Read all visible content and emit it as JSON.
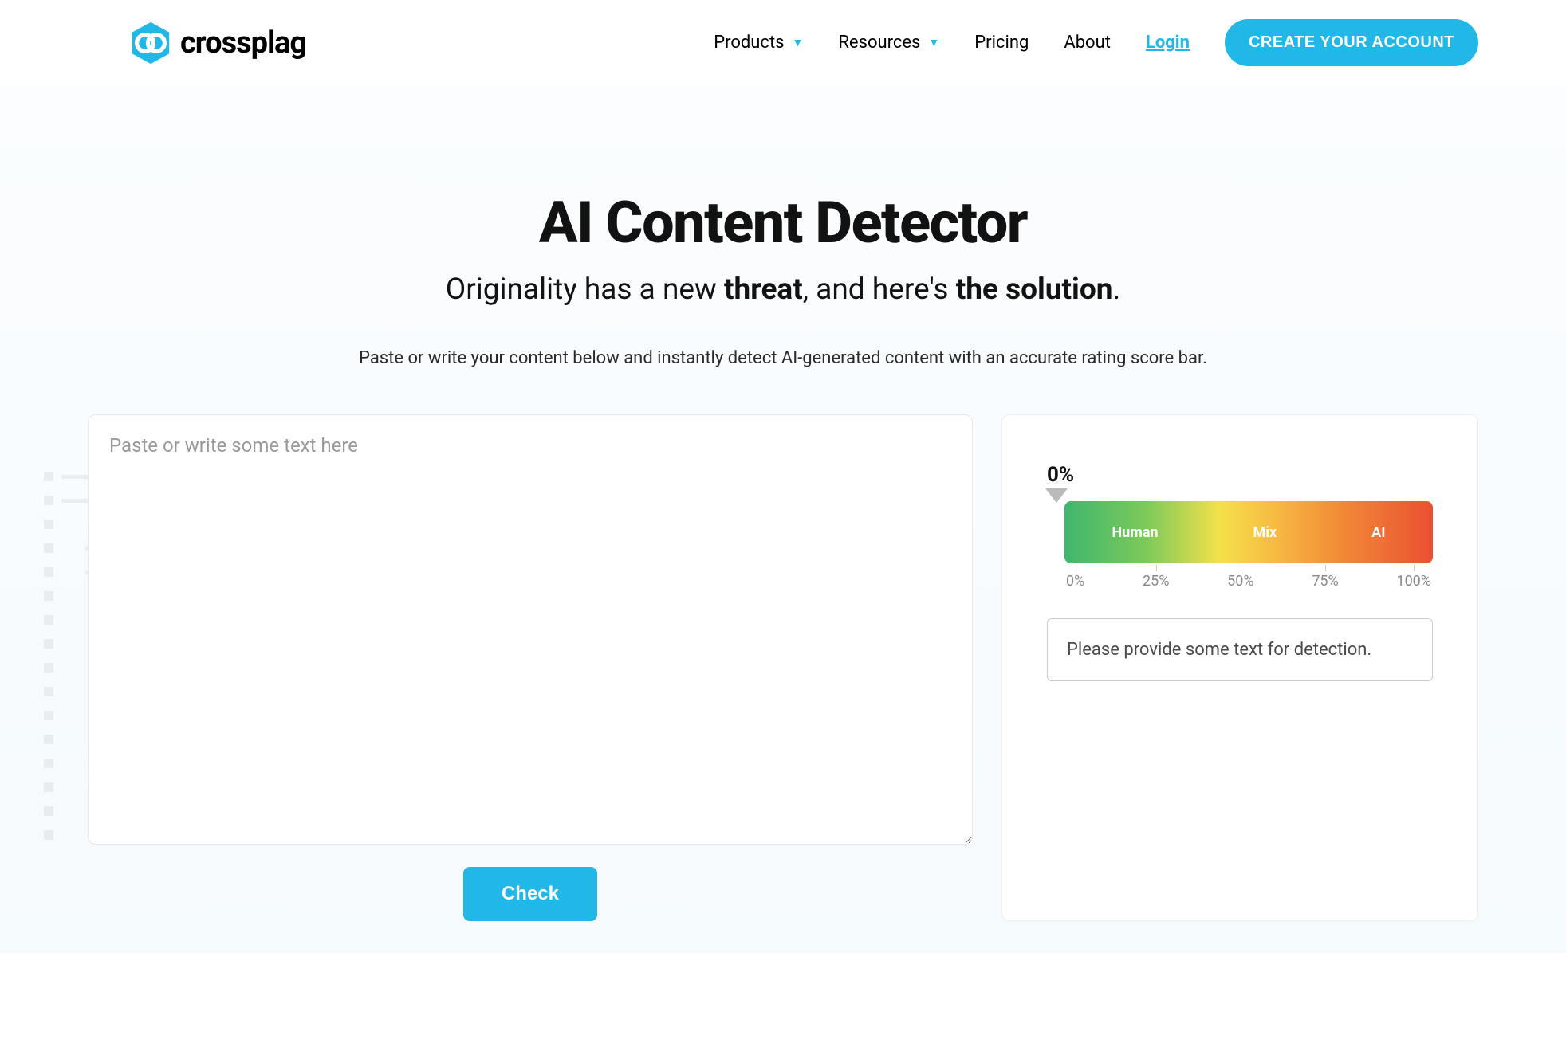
{
  "header": {
    "logo_text": "crossplag",
    "nav": {
      "products": "Products",
      "resources": "Resources",
      "pricing": "Pricing",
      "about": "About",
      "login": "Login",
      "cta": "CREATE YOUR ACCOUNT"
    }
  },
  "hero": {
    "title": "AI Content Detector",
    "subtitle_prefix": "Originality has a new ",
    "subtitle_bold1": "threat",
    "subtitle_mid": ", and here's ",
    "subtitle_bold2": "the solution",
    "subtitle_suffix": ".",
    "description": "Paste or write your content below and instantly detect AI-generated content with an accurate rating score bar."
  },
  "input": {
    "placeholder": "Paste or write some text here",
    "check_button": "Check"
  },
  "result": {
    "score": "0%",
    "bar_labels": {
      "human": "Human",
      "mix": "Mix",
      "ai": "AI"
    },
    "ticks": {
      "t0": "0%",
      "t25": "25%",
      "t50": "50%",
      "t75": "75%",
      "t100": "100%"
    },
    "message": "Please provide some text for detection."
  }
}
